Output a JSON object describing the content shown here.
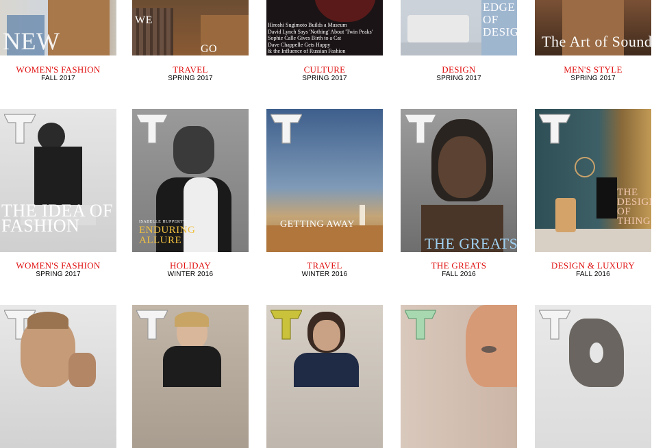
{
  "issues": [
    {
      "section": "WOMEN'S FASHION",
      "season": "FALL 2017",
      "cover_text": "NEW"
    },
    {
      "section": "TRAVEL",
      "season": "SPRING 2017",
      "cover_text": "GO"
    },
    {
      "section": "CULTURE",
      "season": "SPRING 2017",
      "cover_lines": [
        "Hiroshi Sugimoto Builds a Museum",
        "David Lynch Says 'Nothing' About 'Twin Peaks'",
        "Sophie Calle Gives Birth to a Cat",
        "Dave Chappelle Gets Happy",
        "& the Influence of Russian Fashion"
      ]
    },
    {
      "section": "DESIGN",
      "season": "SPRING 2017",
      "cover_text": "EDGE OF DESIGN"
    },
    {
      "section": "MEN'S STYLE",
      "season": "SPRING 2017",
      "cover_text": "The Art of Sound"
    },
    {
      "section": "WOMEN'S FASHION",
      "season": "SPRING 2017",
      "cover_text": "THE IDEA OF FASHION"
    },
    {
      "section": "HOLIDAY",
      "season": "WINTER 2016",
      "cover_text": "ENDURING ALLURE",
      "cover_kicker": "ISABELLE HUPPERT'S"
    },
    {
      "section": "TRAVEL",
      "season": "WINTER 2016",
      "cover_text": "GETTING AWAY"
    },
    {
      "section": "THE GREATS",
      "season": "FALL 2016",
      "cover_text": "THE GREATS"
    },
    {
      "section": "DESIGN & LUXURY",
      "season": "FALL 2016",
      "cover_text": "THE DESIGN OF THINGS"
    },
    {
      "section": "",
      "season": ""
    },
    {
      "section": "",
      "season": ""
    },
    {
      "section": "",
      "season": ""
    },
    {
      "section": "",
      "season": ""
    },
    {
      "section": "",
      "season": ""
    }
  ],
  "colors": {
    "section_label": "#e01010",
    "season_label": "#000000"
  },
  "icons": [
    "t-magazine-logo"
  ]
}
